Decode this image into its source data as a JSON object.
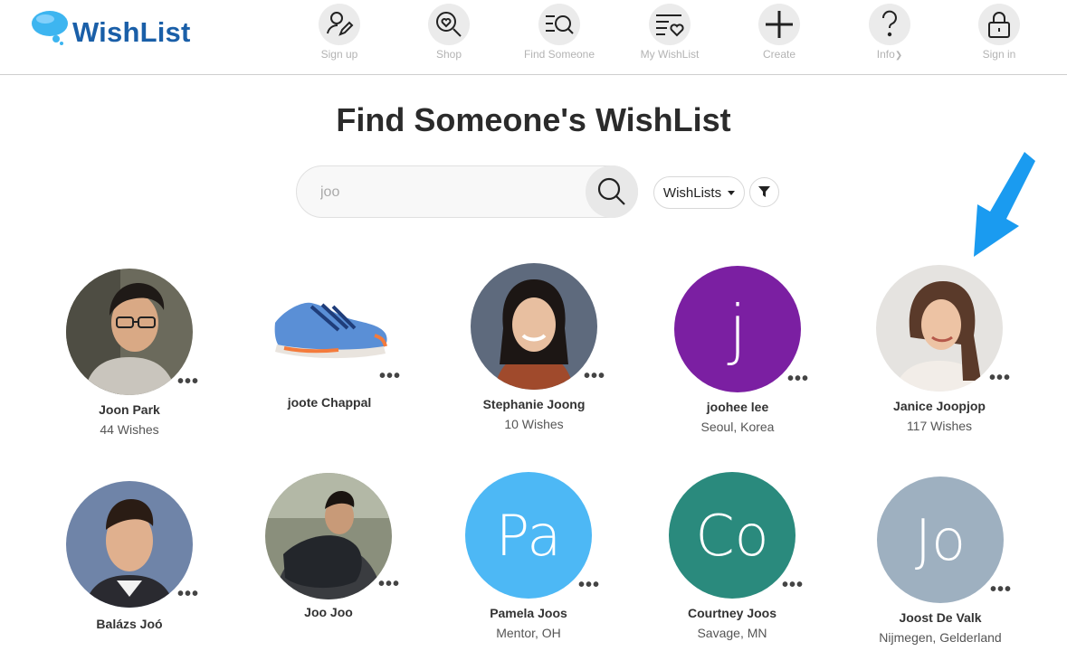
{
  "brand": {
    "name": "WishList",
    "logo_color": "#1a5fa8",
    "bubble_color": "#3db5f0"
  },
  "nav": [
    {
      "label": "Sign up",
      "icon": "user-edit-icon"
    },
    {
      "label": "Shop",
      "icon": "heart-search-icon"
    },
    {
      "label": "Find Someone",
      "icon": "list-search-icon"
    },
    {
      "label": "My WishList",
      "icon": "list-heart-icon"
    },
    {
      "label": "Create",
      "icon": "plus-icon"
    },
    {
      "label": "Info",
      "icon": "question-icon",
      "has_dropdown": true
    },
    {
      "label": "Sign in",
      "icon": "lock-icon"
    }
  ],
  "page": {
    "title": "Find Someone's WishList"
  },
  "search": {
    "value": "joo",
    "placeholder": ""
  },
  "filter": {
    "dropdown_label": "WishLists"
  },
  "results": [
    {
      "name": "Joon Park",
      "sub": "44 Wishes",
      "avatar": "photo-man-glasses"
    },
    {
      "name": "joote Chappal",
      "sub": "",
      "avatar": "photo-sneaker"
    },
    {
      "name": "Stephanie Joong",
      "sub": "10 Wishes",
      "avatar": "photo-woman-smiling"
    },
    {
      "name": "joohee lee",
      "sub": "Seoul, Korea",
      "avatar_text": "j",
      "avatar_color": "#7b1fa2"
    },
    {
      "name": "Janice Joopjop",
      "sub": "117 Wishes",
      "avatar": "photo-woman-brunette"
    },
    {
      "name": "Balázs Joó",
      "sub": "",
      "avatar": "photo-man-suit"
    },
    {
      "name": "Joo Joo",
      "sub": "",
      "avatar": "photo-man-outdoor"
    },
    {
      "name": "Pamela Joos",
      "sub": "Mentor, OH",
      "avatar_text": "Pa",
      "avatar_color": "#4db8f5"
    },
    {
      "name": "Courtney Joos",
      "sub": "Savage, MN",
      "avatar_text": "Co",
      "avatar_color": "#2a8a7d"
    },
    {
      "name": "Joost De Valk",
      "sub": "Nijmegen, Gelderland",
      "avatar_text": "Jo",
      "avatar_color": "#9eb0c0"
    }
  ],
  "annotation": {
    "arrow_color": "#1a9bf0"
  }
}
